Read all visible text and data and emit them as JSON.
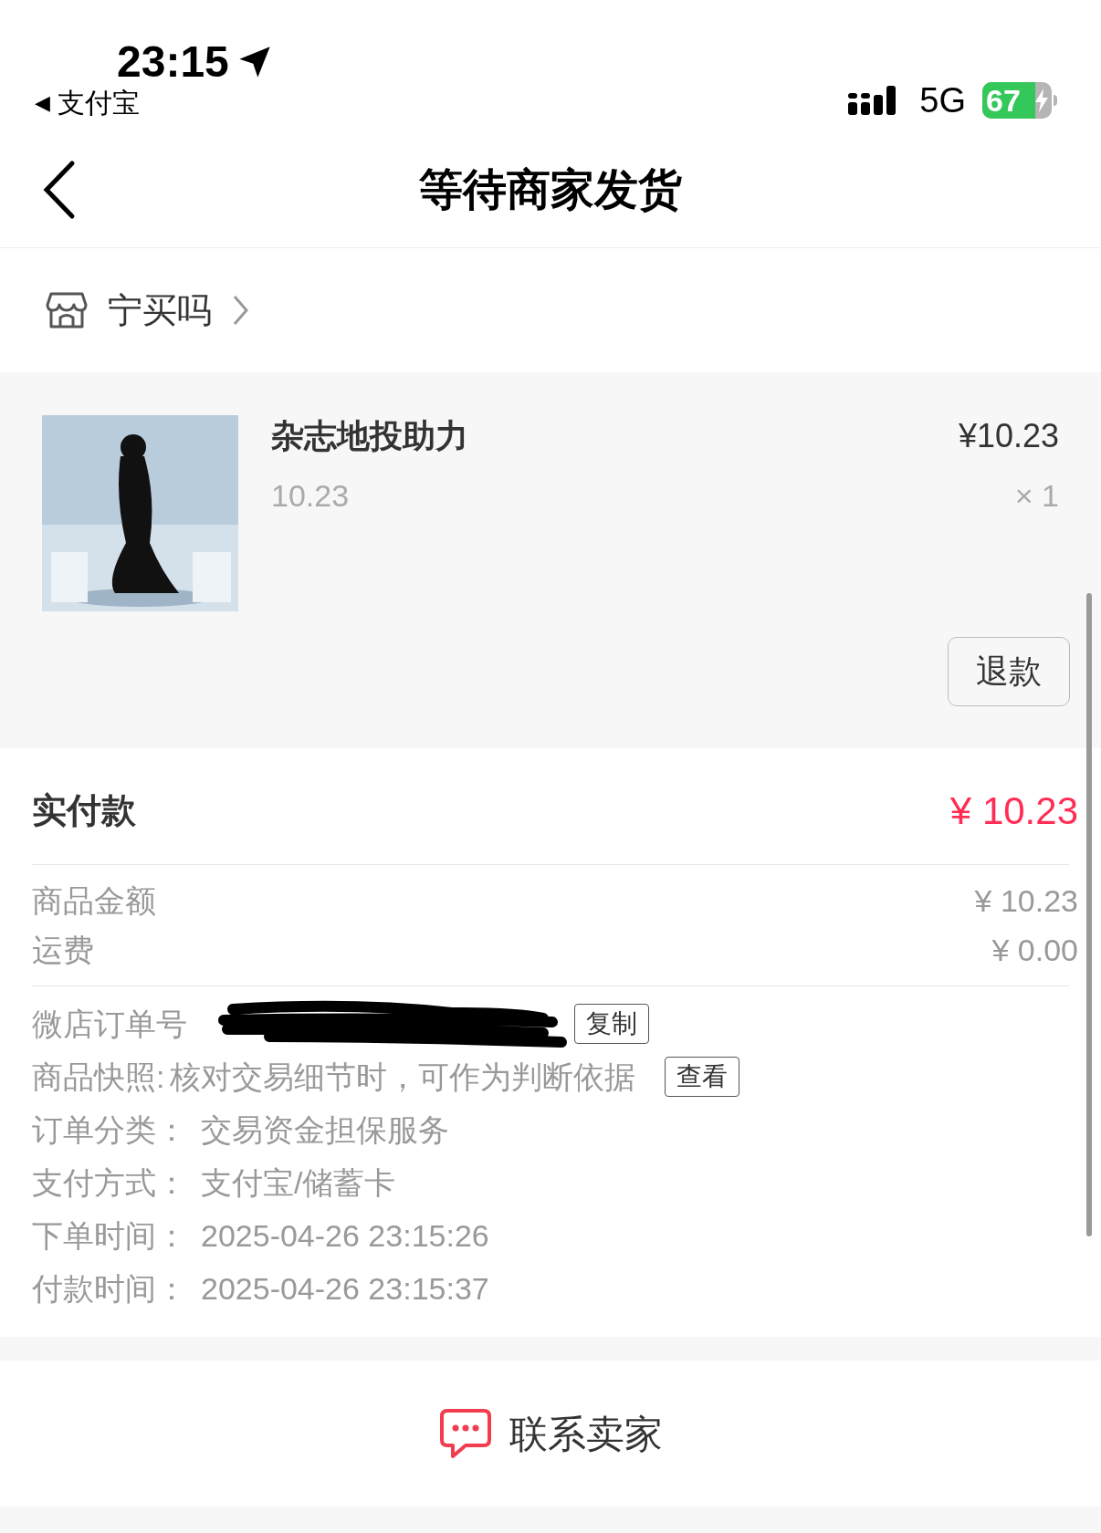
{
  "status_bar": {
    "time": "23:15",
    "back_arrow": "◀",
    "back_app": "支付宝",
    "network": "5G",
    "battery": "67"
  },
  "nav": {
    "title": "等待商家发货"
  },
  "store": {
    "name": "宁买吗"
  },
  "product": {
    "title": "杂志地投助力",
    "spec": "10.23",
    "price": "¥10.23",
    "quantity": "× 1"
  },
  "refund_button": "退款",
  "payment": {
    "label": "实付款",
    "amount": "¥ 10.23"
  },
  "costs": [
    {
      "label": "商品金额",
      "value": "¥ 10.23"
    },
    {
      "label": "运费",
      "value": "¥ 0.00"
    }
  ],
  "details": [
    {
      "kind": "copy",
      "label": "微店订单号",
      "button": "复制"
    },
    {
      "kind": "snapshot",
      "label": "商品快照:",
      "value": "核对交易细节时，可作为判断依据",
      "button": "查看"
    },
    {
      "kind": "plain",
      "label": "订单分类：",
      "value": "交易资金担保服务"
    },
    {
      "kind": "plain",
      "label": "支付方式：",
      "value": "支付宝/储蓄卡"
    },
    {
      "kind": "plain",
      "label": "下单时间：",
      "value": "2025-04-26 23:15:26"
    },
    {
      "kind": "plain",
      "label": "付款时间：",
      "value": "2025-04-26 23:15:37"
    }
  ],
  "contact_button": "联系卖家"
}
